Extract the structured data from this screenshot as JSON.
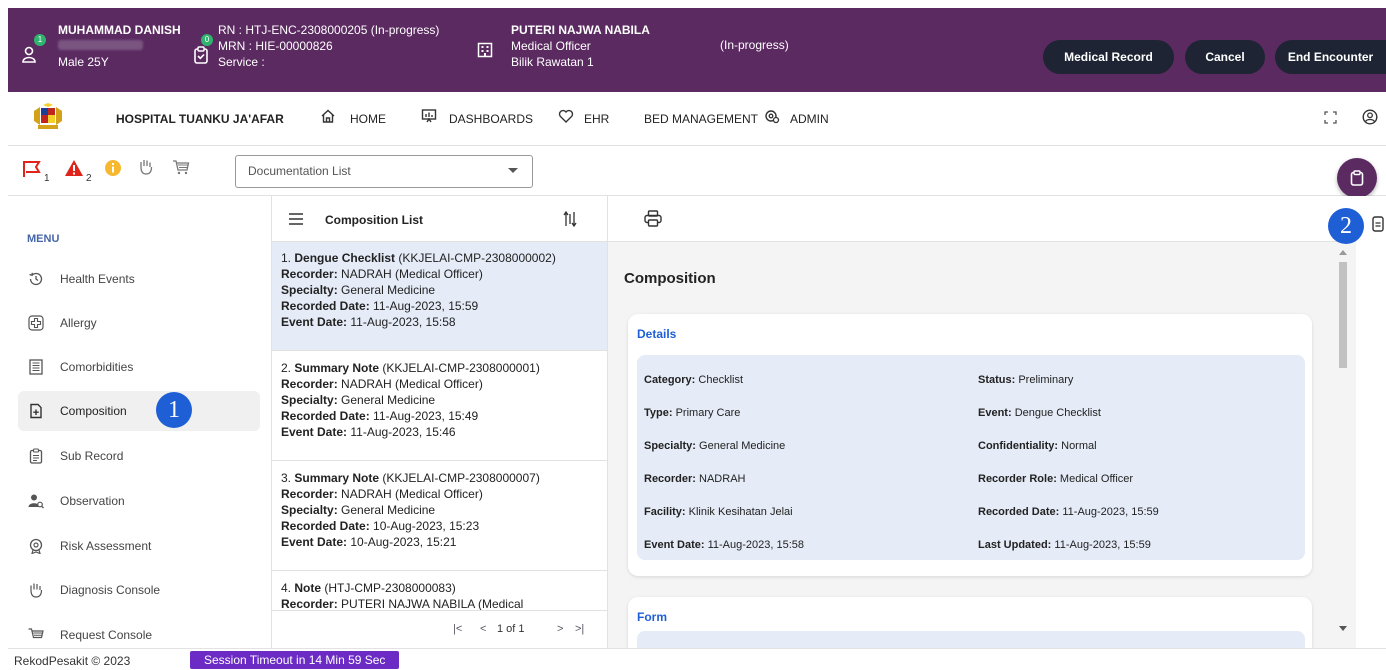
{
  "patient": {
    "name": "MUHAMMAD DANISH",
    "sex_age": "Male 25Y",
    "badge_a": "1",
    "badge_b": "0",
    "rn": "RN : HTJ-ENC-2308000205 (In-progress)",
    "mrn": "MRN : HIE-00000826",
    "service": "Service :",
    "doctor": "PUTERI NAJWA NABILA",
    "doctor_role": "Medical Officer",
    "location": "Bilik Rawatan 1",
    "status": "(In-progress)"
  },
  "banner_buttons": {
    "medical_record": "Medical Record",
    "cancel": "Cancel",
    "end_encounter": "End Encounter"
  },
  "topnav": {
    "hospital": "HOSPITAL TUANKU JA'AFAR",
    "home": "HOME",
    "dashboards": "DASHBOARDS",
    "ehr": "EHR",
    "bed_management": "BED MANAGEMENT",
    "admin": "ADMIN"
  },
  "toolbar": {
    "flag_count": "1",
    "alert_count": "2",
    "dropdown_value": "Documentation List"
  },
  "sidebar": {
    "menu_label": "MENU",
    "items": [
      {
        "label": "Health Events"
      },
      {
        "label": "Allergy"
      },
      {
        "label": "Comorbidities"
      },
      {
        "label": "Composition"
      },
      {
        "label": "Sub Record"
      },
      {
        "label": "Observation"
      },
      {
        "label": "Risk Assessment"
      },
      {
        "label": "Diagnosis Console"
      },
      {
        "label": "Request Console"
      }
    ]
  },
  "callouts": {
    "one": "1",
    "two": "2"
  },
  "composition_list": {
    "title": "Composition List",
    "recorder_label": "Recorder:",
    "specialty_label": "Specialty:",
    "recorded_label": "Recorded Date:",
    "event_label": "Event Date:",
    "items": [
      {
        "num": "1.",
        "title": "Dengue Checklist",
        "code": "(KKJELAI-CMP-2308000002)",
        "recorder": "NADRAH (Medical Officer)",
        "specialty": "General Medicine",
        "recorded": "11-Aug-2023, 15:59",
        "event": "11-Aug-2023, 15:58"
      },
      {
        "num": "2.",
        "title": "Summary Note",
        "code": "(KKJELAI-CMP-2308000001)",
        "recorder": "NADRAH (Medical Officer)",
        "specialty": "General Medicine",
        "recorded": "11-Aug-2023, 15:49",
        "event": "11-Aug-2023, 15:46"
      },
      {
        "num": "3.",
        "title": "Summary Note",
        "code": "(KKJELAI-CMP-2308000007)",
        "recorder": "NADRAH (Medical Officer)",
        "specialty": "General Medicine",
        "recorded": "10-Aug-2023, 15:23",
        "event": "10-Aug-2023, 15:21"
      },
      {
        "num": "4.",
        "title": "Note",
        "code": "(HTJ-CMP-2308000083)",
        "recorder": "PUTERI NAJWA NABILA (Medical"
      }
    ],
    "pager": "1 of 1"
  },
  "composition": {
    "title": "Composition",
    "details_label": "Details",
    "form_label": "Form",
    "fields_left": [
      {
        "label": "Category:",
        "value": "Checklist"
      },
      {
        "label": "Type:",
        "value": "Primary Care"
      },
      {
        "label": "Specialty:",
        "value": "General Medicine"
      },
      {
        "label": "Recorder:",
        "value": "NADRAH"
      },
      {
        "label": "Facility:",
        "value": "Klinik Kesihatan Jelai"
      },
      {
        "label": "Event Date:",
        "value": "11-Aug-2023, 15:58"
      }
    ],
    "fields_right": [
      {
        "label": "Status:",
        "value": "Preliminary"
      },
      {
        "label": "Event:",
        "value": "Dengue Checklist"
      },
      {
        "label": "Confidentiality:",
        "value": "Normal"
      },
      {
        "label": "Recorder Role:",
        "value": "Medical Officer"
      },
      {
        "label": "Recorded Date:",
        "value": "11-Aug-2023, 15:59"
      },
      {
        "label": "Last Updated:",
        "value": "11-Aug-2023, 15:59"
      }
    ]
  },
  "footer": {
    "copyright": "RekodPesakit © 2023",
    "session": "Session Timeout in 14 Min 59 Sec"
  }
}
